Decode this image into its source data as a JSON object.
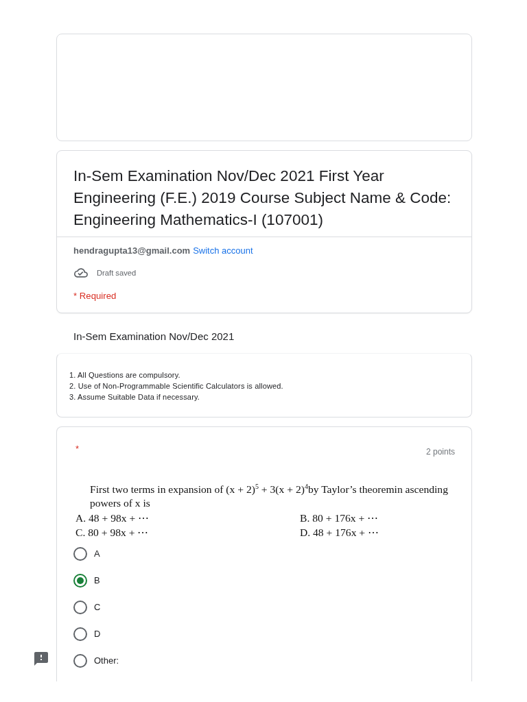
{
  "form": {
    "title": "In-Sem Examination Nov/Dec 2021 First Year Engineering (F.E.) 2019 Course Subject Name & Code: Engineering Mathematics-I (107001)",
    "account_email": "hendragupta13@gmail.com",
    "switch_account_link": "Switch account",
    "draft_status": "Draft saved",
    "required_note": "* Required"
  },
  "section": {
    "title": "In-Sem Examination Nov/Dec 2021",
    "description_lines": [
      "1. All Questions are compulsory.",
      "2. Use of Non-Programmable Scientific Calculators is allowed.",
      "3. Assume Suitable Data if necessary."
    ]
  },
  "question": {
    "required_mark": "*",
    "points": "2 points",
    "prompt": "First two terms in expansion of (x + 2)$^{5}$ + 3(x + 2)$^{4}$by Taylor’s theoremin ascending powers of x is",
    "choices": [
      "A. 48 + 98x + ⋯",
      "B. 80 + 176x + ⋯",
      "C. 80 + 98x + ⋯",
      "D. 48 + 176x + ⋯"
    ],
    "options": [
      {
        "label": "A",
        "selected": false
      },
      {
        "label": "B",
        "selected": true
      },
      {
        "label": "C",
        "selected": false
      },
      {
        "label": "D",
        "selected": false
      },
      {
        "label": "Other:",
        "selected": false
      }
    ]
  }
}
